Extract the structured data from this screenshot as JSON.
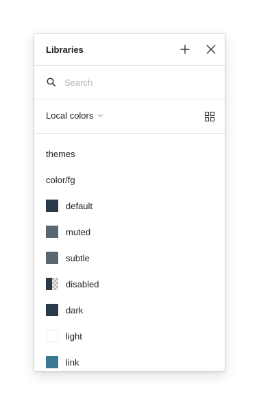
{
  "panel": {
    "title": "Libraries",
    "add_icon": "plus-icon",
    "close_icon": "close-icon"
  },
  "search": {
    "placeholder": "Search",
    "value": "",
    "icon": "search-icon"
  },
  "filter": {
    "selected": "Local colors",
    "chevron_icon": "chevron-down-icon",
    "view_icon": "grid-view-icon"
  },
  "groups": {
    "theme": "themes",
    "subgroup": "color/fg"
  },
  "colors": [
    {
      "name": "default",
      "color": "#2b3a49"
    },
    {
      "name": "muted",
      "color": "#5b6770"
    },
    {
      "name": "subtle",
      "color": "#5b6770"
    },
    {
      "name": "disabled",
      "color": "#2b3a49"
    },
    {
      "name": "dark",
      "color": "#2b3a49"
    },
    {
      "name": "light",
      "color": "#ffffff"
    },
    {
      "name": "link",
      "color": "#3a7891"
    }
  ]
}
